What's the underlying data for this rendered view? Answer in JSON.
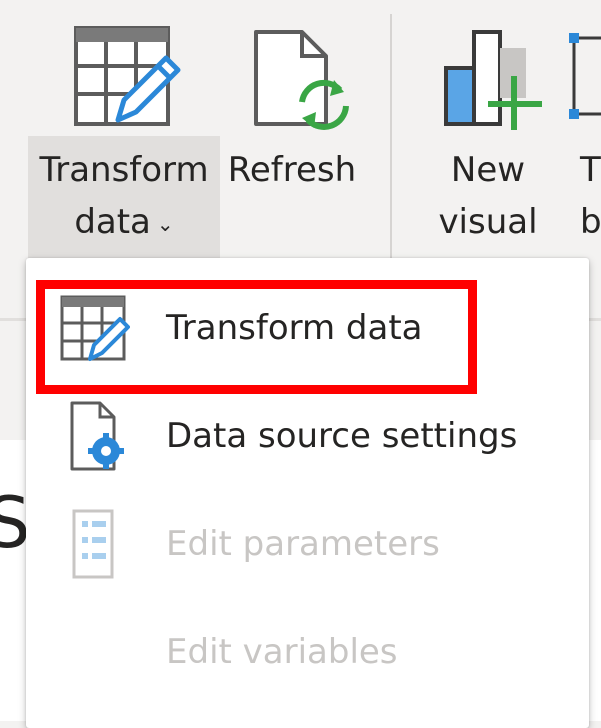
{
  "ribbon": {
    "transform": {
      "line1": "Transform",
      "line2": "data",
      "chevron": "⌄",
      "icon": "table-pencil-icon"
    },
    "refresh": {
      "label": "Refresh",
      "icon": "refresh-document-icon"
    },
    "new_visual": {
      "line1": "New",
      "line2": "visual",
      "icon": "bar-chart-add-icon"
    },
    "partial": {
      "line1": "T",
      "line2": "b",
      "icon": "textbox-icon"
    }
  },
  "dropdown": {
    "items": [
      {
        "label": "Transform data",
        "icon": "table-pencil-icon",
        "enabled": true,
        "highlighted": true
      },
      {
        "label": "Data source settings",
        "icon": "document-gear-icon",
        "enabled": true
      },
      {
        "label": "Edit parameters",
        "icon": "parameters-list-icon",
        "enabled": false
      },
      {
        "label": "Edit variables",
        "icon": "",
        "enabled": false
      }
    ]
  },
  "background": {
    "partial_text": "S"
  },
  "colors": {
    "accent_blue": "#2b88d8",
    "refresh_green": "#3aa645",
    "highlight_red": "#ff0000",
    "disabled_text": "#c8c6c4"
  }
}
